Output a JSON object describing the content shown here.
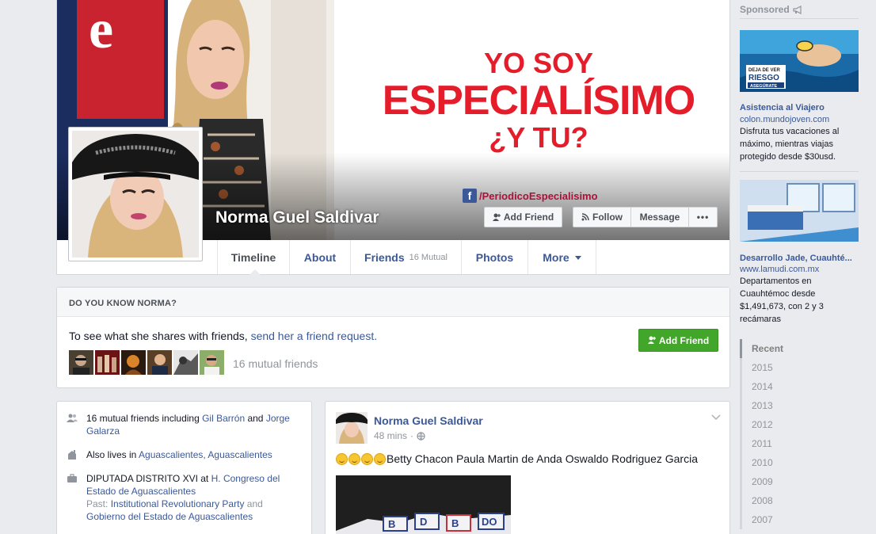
{
  "cover": {
    "line1": "YO SOY",
    "line2": "ESPECIALÍSIMO",
    "line3": "¿Y TU?",
    "fb_handle": "/PeriodicoEspecialisimo"
  },
  "profile": {
    "name": "Norma Guel Saldivar"
  },
  "header_buttons": {
    "add_friend": "Add Friend",
    "follow": "Follow",
    "message": "Message",
    "more": "•••"
  },
  "tabs": {
    "timeline": "Timeline",
    "about": "About",
    "friends": "Friends",
    "friends_mutual": "16 Mutual",
    "photos": "Photos",
    "more": "More"
  },
  "know": {
    "heading": "DO YOU KNOW NORMA?",
    "text_before": "To see what she shares with friends, ",
    "text_link": "send her a friend request.",
    "add_friend": "Add Friend",
    "mutual_friends": "16 mutual friends"
  },
  "intro": {
    "friends_prefix": "16 mutual friends including ",
    "friend1": "Gil Barrón",
    "and": " and ",
    "friend2": "Jorge Galarza",
    "lives_prefix": "Also lives in ",
    "lives_place": "Aguascalientes, Aguascalientes",
    "work_title": "DIPUTADA DISTRITO XVI",
    "work_at": " at ",
    "work_org": "H. Congreso del Estado de Aguascalientes",
    "past_label": "Past: ",
    "past_org1": "Institutional Revolutionary Party",
    "past_and": " and ",
    "past_org2": "Gobierno del Estado de Aguascalientes"
  },
  "post": {
    "author": "Norma Guel Saldivar",
    "time": "48 mins",
    "separator": "·",
    "text": "Betty Chacon Paula Martin de Anda Oswaldo Rodriguez Garcia"
  },
  "sidebar": {
    "sponsored": "Sponsored",
    "ads": [
      {
        "title": "Asistencia al Viajero",
        "url": "colon.mundojoven.com",
        "desc": "Disfruta tus vacaciones al máximo, mientras viajas protegido desde $30usd.",
        "img_text1": "DEJA DE VER",
        "img_text2": "RIESGO",
        "img_text3": "ASEGÚRATE"
      },
      {
        "title": "Desarrollo Jade, Cuauhté...",
        "url": "www.lamudi.com.mx",
        "desc": "Departamentos en Cuauhtémoc desde $1,491,673, con 2 y 3 recámaras"
      }
    ],
    "years": [
      "Recent",
      "2015",
      "2014",
      "2013",
      "2012",
      "2011",
      "2010",
      "2009",
      "2008",
      "2007"
    ]
  },
  "colors": {
    "fb_blue": "#3b5998",
    "brand_red": "#e51d2b",
    "green_button": "#42a62a",
    "page_bg": "#e9ebee"
  }
}
